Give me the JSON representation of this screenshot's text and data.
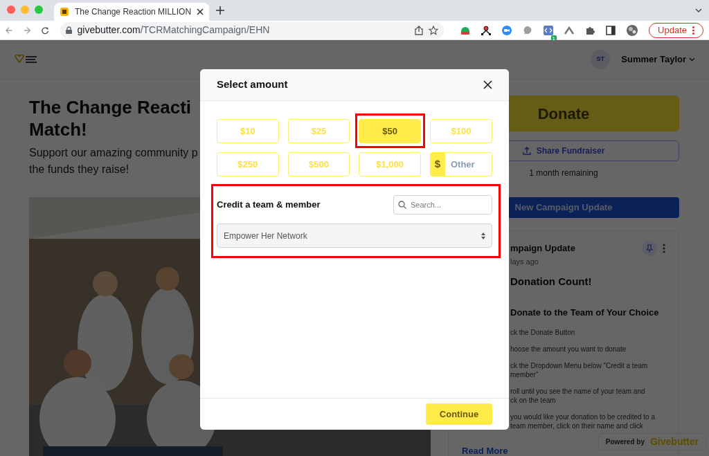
{
  "browser": {
    "tabs": [
      {
        "title": "The Change Reaction MILLION",
        "selected": true
      }
    ],
    "url_host": "givebutter.com",
    "url_path": "/TCRMatchingCampaign/EHN",
    "extension_badge": "1",
    "update_label": "Update"
  },
  "header": {
    "profile_initials": "ST",
    "profile_name": "Summer Taylor"
  },
  "campaign": {
    "title_lines": [
      "The Change Reacti",
      "Match!"
    ],
    "subtitle_lines": [
      "Support our amazing community p",
      "the funds they raise!"
    ]
  },
  "sidebar": {
    "donate_label": "Donate",
    "share_label": "Share Fundraiser",
    "remaining": "1 month remaining",
    "update_button": "New Campaign Update"
  },
  "update_card": {
    "title": "mpaign Update",
    "time": "lays ago",
    "heading": "Donation Count!",
    "subheading": "Donate to the Team of Your Choice",
    "steps": [
      [
        "ck the Donate Button"
      ],
      [
        "hoose the amount you want to donate"
      ],
      [
        "ck the Dropdown Menu below \"Credit a team",
        "member\""
      ],
      [
        "roll until you see the name of your team and",
        "ck on the team"
      ],
      [
        "you would like your donation to be credited to a",
        "team member, click on their name and click"
      ]
    ],
    "read_more": "Read More"
  },
  "powered_by": {
    "prefix": "Powered by",
    "brand": "Givebutter"
  },
  "modal": {
    "title": "Select amount",
    "amounts": [
      {
        "label": "$10",
        "selected": false,
        "highlighted": false
      },
      {
        "label": "$25",
        "selected": false,
        "highlighted": false
      },
      {
        "label": "$50",
        "selected": true,
        "highlighted": true
      },
      {
        "label": "$100",
        "selected": false,
        "highlighted": false
      },
      {
        "label": "$250",
        "selected": false,
        "highlighted": false
      },
      {
        "label": "$500",
        "selected": false,
        "highlighted": false
      },
      {
        "label": "$1,000",
        "selected": false,
        "highlighted": false
      }
    ],
    "other": {
      "symbol": "$",
      "placeholder": "Other"
    },
    "credit": {
      "label": "Credit a team & member",
      "search_placeholder": "Search...",
      "selected_team": "Empower Her Network",
      "highlighted": true
    },
    "continue_label": "Continue"
  }
}
